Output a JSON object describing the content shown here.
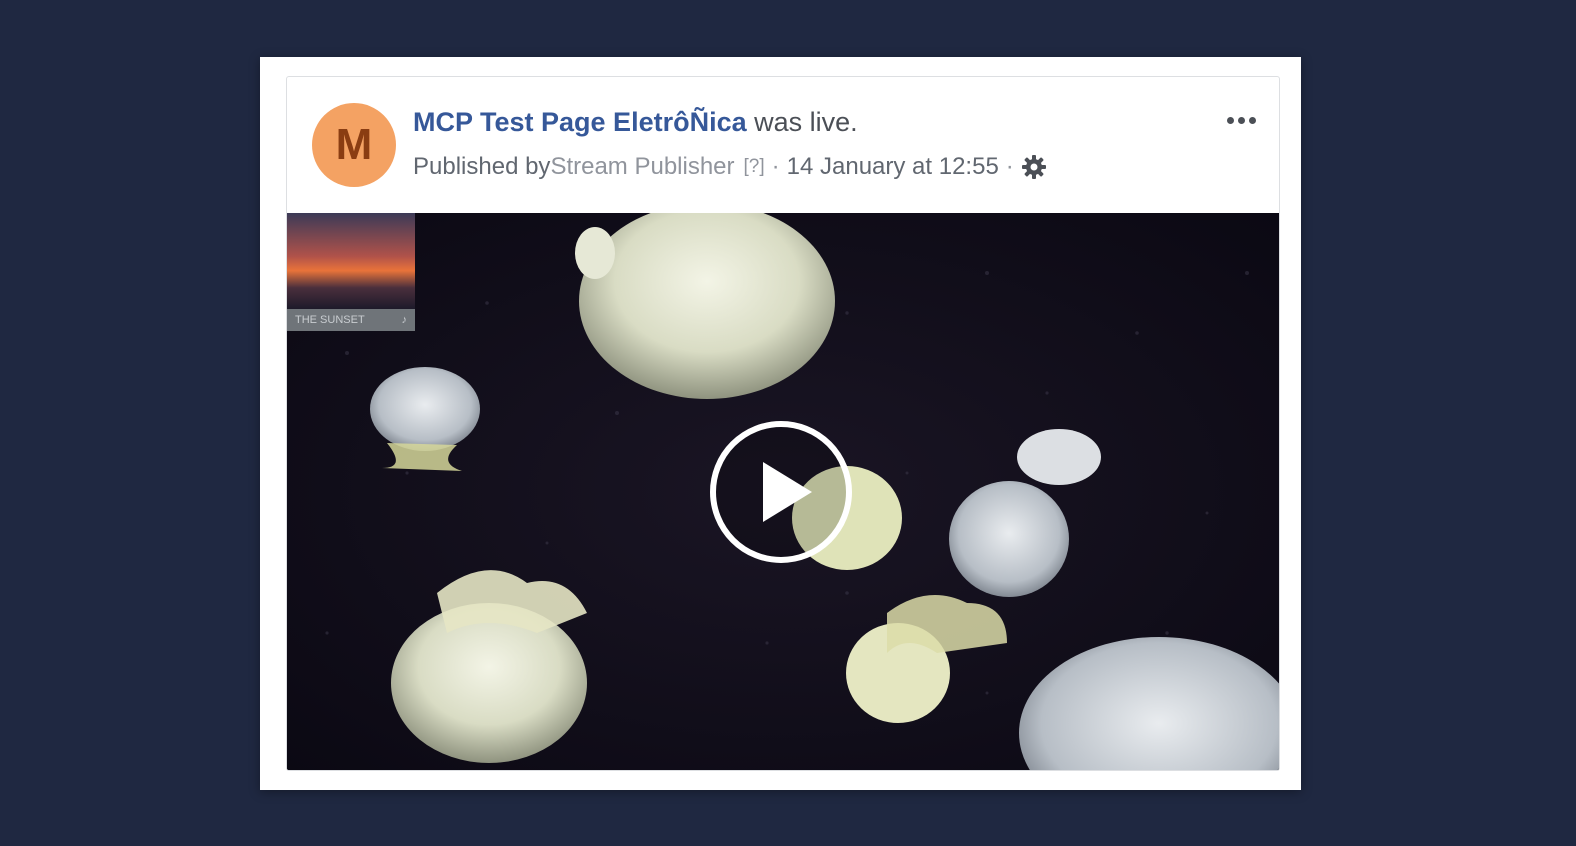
{
  "post": {
    "avatar_letter": "M",
    "page_name": "MCP Test Page EletrôÑica",
    "status_text": " was live.",
    "published_by_label": "Published by ",
    "publisher_name": "Stream Publisher",
    "help_marker": "[?]",
    "separator": "·",
    "timestamp": "14 January at 12:55"
  },
  "video": {
    "thumbnail_caption": "THE SUNSET",
    "thumbnail_icon": "music-note-icon"
  },
  "icons": {
    "more": "more-options-icon",
    "gear": "gear-icon",
    "play": "play-icon"
  },
  "colors": {
    "page_background": "#1f2841",
    "link_blue": "#365899",
    "avatar_bg": "#f4a263"
  }
}
